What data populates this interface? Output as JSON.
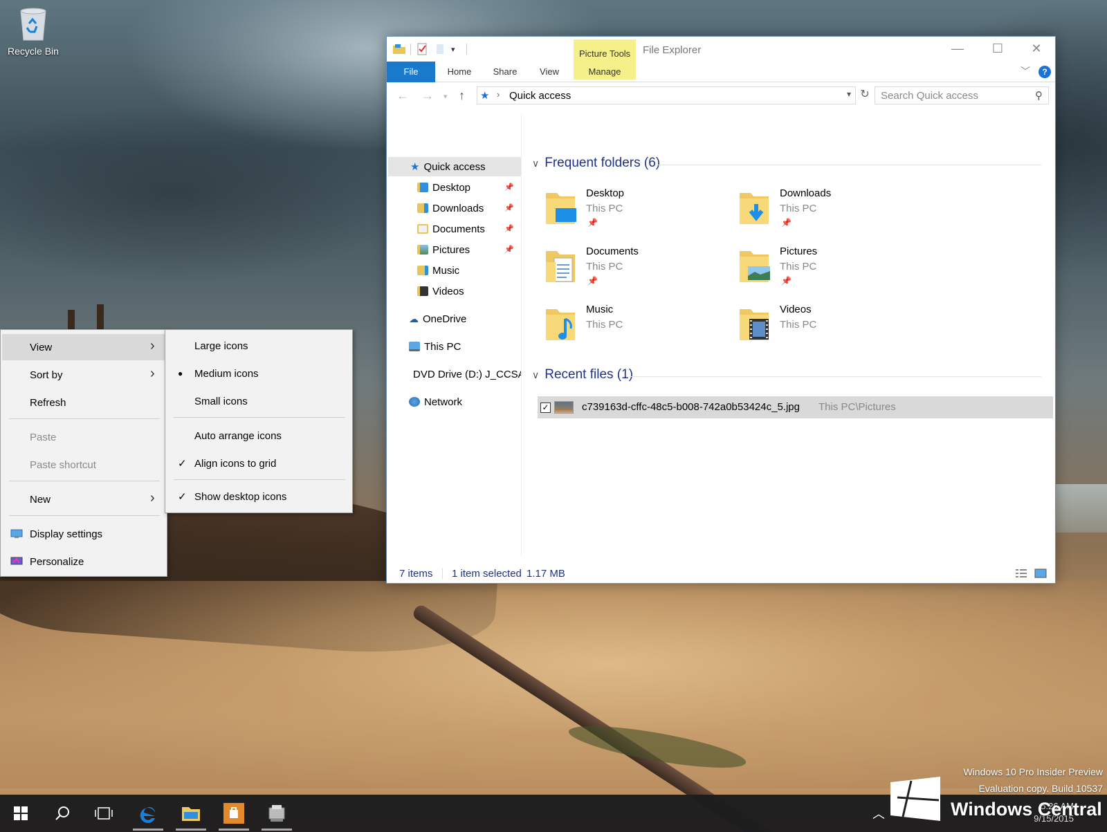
{
  "desktop": {
    "recycle_bin_label": "Recycle Bin"
  },
  "explorer": {
    "title": "File Explorer",
    "contextual_tab_group": "Picture Tools",
    "ribbon_tabs": [
      "File",
      "Home",
      "Share",
      "View",
      "Manage"
    ],
    "help_label": "?",
    "address": {
      "location": "Quick access",
      "search_placeholder": "Search Quick access"
    },
    "nav": {
      "quick_access": "Quick access",
      "pinned": [
        "Desktop",
        "Downloads",
        "Documents",
        "Pictures"
      ],
      "unpinned": [
        "Music",
        "Videos"
      ],
      "onedrive": "OneDrive",
      "this_pc": "This PC",
      "dvd": "DVD Drive (D:) J_CCSA",
      "network": "Network"
    },
    "frequent_header": "Frequent folders (6)",
    "folders": [
      {
        "name": "Desktop",
        "location": "This PC"
      },
      {
        "name": "Downloads",
        "location": "This PC"
      },
      {
        "name": "Documents",
        "location": "This PC"
      },
      {
        "name": "Pictures",
        "location": "This PC"
      },
      {
        "name": "Music",
        "location": "This PC"
      },
      {
        "name": "Videos",
        "location": "This PC"
      }
    ],
    "recent_header": "Recent files (1)",
    "recent_files": [
      {
        "name": "c739163d-cffc-48c5-b008-742a0b53424c_5.jpg",
        "path": "This PC\\Pictures",
        "checked": true
      }
    ],
    "status": {
      "item_count": "7 items",
      "selection": "1 item selected",
      "size": "1.17 MB"
    }
  },
  "context_menu": {
    "items": [
      {
        "label": "View",
        "submenu": true,
        "highlighted": true
      },
      {
        "label": "Sort by",
        "submenu": true
      },
      {
        "label": "Refresh"
      },
      {
        "label": "Paste",
        "disabled": true
      },
      {
        "label": "Paste shortcut",
        "disabled": true
      },
      {
        "label": "New",
        "submenu": true
      },
      {
        "label": "Display settings"
      },
      {
        "label": "Personalize"
      }
    ]
  },
  "view_submenu": {
    "items": [
      {
        "label": "Large icons"
      },
      {
        "label": "Medium icons",
        "selected": true
      },
      {
        "label": "Small icons"
      },
      {
        "label": "Auto arrange icons"
      },
      {
        "label": "Align icons to grid",
        "checked": true
      },
      {
        "label": "Show desktop icons",
        "checked": true
      }
    ]
  },
  "taskbar": {
    "apps": [
      "start-icon",
      "search-icon",
      "task-view-icon",
      "edge-icon",
      "file-explorer-icon",
      "store-icon",
      "app-icon"
    ],
    "clock_time": "5:26 AM",
    "clock_date": "9/15/2015"
  },
  "watermark": {
    "line1": "Windows 10 Pro Insider Preview",
    "line2": "Evaluation copy. Build 10537",
    "brand": "Windows Central"
  },
  "colors": {
    "accent": "#1979ca",
    "header_blue": "#1e3287",
    "picture_tools": "#f6f08a"
  }
}
